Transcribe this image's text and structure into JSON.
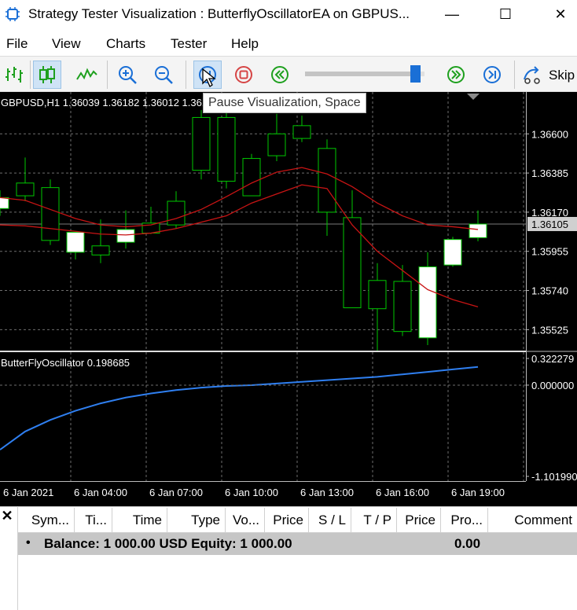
{
  "window": {
    "title": "Strategy Tester Visualization : ButterflyOscillatorEA on GBPUS...",
    "minimize_glyph": "—",
    "maximize_glyph": "☐",
    "close_glyph": "✕"
  },
  "menu": {
    "file": "File",
    "view": "View",
    "charts": "Charts",
    "tester": "Tester",
    "help": "Help"
  },
  "toolbar": {
    "icons": [
      "bar-chart-icon",
      "candlestick-icon",
      "line-chart-icon",
      "zoom-in-icon",
      "zoom-out-icon",
      "pause-icon",
      "stop-icon",
      "rewind-icon",
      "fast-forward-icon",
      "step-forward-icon",
      "skip-icon"
    ],
    "skip_label": "Skip",
    "speed_level": 0.92,
    "colors": {
      "green": "#1ea01e",
      "blue": "#1a6fd6",
      "red": "#d64545"
    }
  },
  "tooltip": {
    "text": "Pause Visualization, Space"
  },
  "chart": {
    "header": "GBPUSD,H1  1.36039 1.36182 1.36012 1.36105",
    "indicator_label": "ButterFlyOscillator 0.198685",
    "current_price_label": "1.36105",
    "price_ticks": [
      "1.36600",
      "1.36385",
      "1.36170",
      "1.35955",
      "1.35740",
      "1.35525"
    ],
    "osc_ticks": [
      "0.322279",
      "0.000000",
      "-1.101990"
    ],
    "time_labels": [
      "6 Jan 2021",
      "6 Jan 04:00",
      "6 Jan 07:00",
      "6 Jan 10:00",
      "6 Jan 13:00",
      "6 Jan 16:00",
      "6 Jan 19:00"
    ],
    "colors": {
      "background": "#000000",
      "grid": "#6e6e6e",
      "bull_body": "#ffffff",
      "wick": "#00c800",
      "ma": "#c81414",
      "osc": "#2f7ff0",
      "axis_text": "#ffffff"
    }
  },
  "chart_data": {
    "type": "candlestick",
    "symbol": "GBPUSD",
    "timeframe": "H1",
    "ylim": [
      1.3541,
      1.3683
    ],
    "candles": [
      {
        "o": 1.3619,
        "h": 1.3629,
        "l": 1.3615,
        "c": 1.3625
      },
      {
        "o": 1.3633,
        "h": 1.3647,
        "l": 1.3623,
        "c": 1.3626
      },
      {
        "o": 1.36305,
        "h": 1.3635,
        "l": 1.3599,
        "c": 1.36015
      },
      {
        "o": 1.3595,
        "h": 1.3603,
        "l": 1.3591,
        "c": 1.3606
      },
      {
        "o": 1.35985,
        "h": 1.3613,
        "l": 1.3589,
        "c": 1.35935
      },
      {
        "o": 1.36005,
        "h": 1.3618,
        "l": 1.3597,
        "c": 1.36075
      },
      {
        "o": 1.3611,
        "h": 1.362,
        "l": 1.3605,
        "c": 1.36055
      },
      {
        "o": 1.3623,
        "h": 1.36285,
        "l": 1.3608,
        "c": 1.361
      },
      {
        "o": 1.3669,
        "h": 1.3673,
        "l": 1.3635,
        "c": 1.364
      },
      {
        "o": 1.3669,
        "h": 1.3674,
        "l": 1.363,
        "c": 1.3634
      },
      {
        "o": 1.36465,
        "h": 1.3649,
        "l": 1.3626,
        "c": 1.3626
      },
      {
        "o": 1.366,
        "h": 1.3671,
        "l": 1.3645,
        "c": 1.3648
      },
      {
        "o": 1.36645,
        "h": 1.367,
        "l": 1.36555,
        "c": 1.36575
      },
      {
        "o": 1.3652,
        "h": 1.3657,
        "l": 1.3604,
        "c": 1.3617
      },
      {
        "o": 1.3614,
        "h": 1.3629,
        "l": 1.3584,
        "c": 1.35645
      },
      {
        "o": 1.35795,
        "h": 1.3589,
        "l": 1.3541,
        "c": 1.3564
      },
      {
        "o": 1.3579,
        "h": 1.3588,
        "l": 1.3549,
        "c": 1.35515
      },
      {
        "o": 1.3548,
        "h": 1.3595,
        "l": 1.3544,
        "c": 1.3587
      },
      {
        "o": 1.3588,
        "h": 1.36035,
        "l": 1.3587,
        "c": 1.3602
      },
      {
        "o": 1.3603,
        "h": 1.3618,
        "l": 1.3601,
        "c": 1.36105
      }
    ],
    "ma_fast": [
      1.3625,
      1.36235,
      1.36185,
      1.36135,
      1.361,
      1.3609,
      1.361,
      1.36135,
      1.36185,
      1.36255,
      1.3633,
      1.3639,
      1.36415,
      1.3638,
      1.3631,
      1.3622,
      1.3615,
      1.361,
      1.3609,
      1.36075
    ],
    "ma_slow": [
      1.361,
      1.36095,
      1.3608,
      1.36065,
      1.3605,
      1.36045,
      1.36055,
      1.3608,
      1.36115,
      1.3615,
      1.3622,
      1.3627,
      1.3632,
      1.363,
      1.361,
      1.35955,
      1.3585,
      1.35745,
      1.3569,
      1.3565
    ],
    "oscillator": {
      "ylim": [
        -1.10199,
        0.322279
      ],
      "values": [
        -0.78,
        -0.56,
        -0.42,
        -0.31,
        -0.22,
        -0.15,
        -0.1,
        -0.06,
        -0.03,
        -0.01,
        0.0,
        0.02,
        0.04,
        0.06,
        0.08,
        0.1,
        0.13,
        0.16,
        0.19,
        0.22
      ]
    }
  },
  "trade_panel": {
    "columns": [
      "Sym...",
      "Ti...",
      "Time",
      "Type",
      "Vo...",
      "Price",
      "S / L",
      "T / P",
      "Price",
      "Pro...",
      "Comment"
    ],
    "balance_bullet": "•",
    "balance_text": "Balance: 1 000.00 USD  Equity: 1 000.00",
    "profit": "0.00",
    "close_glyph": "✕"
  }
}
